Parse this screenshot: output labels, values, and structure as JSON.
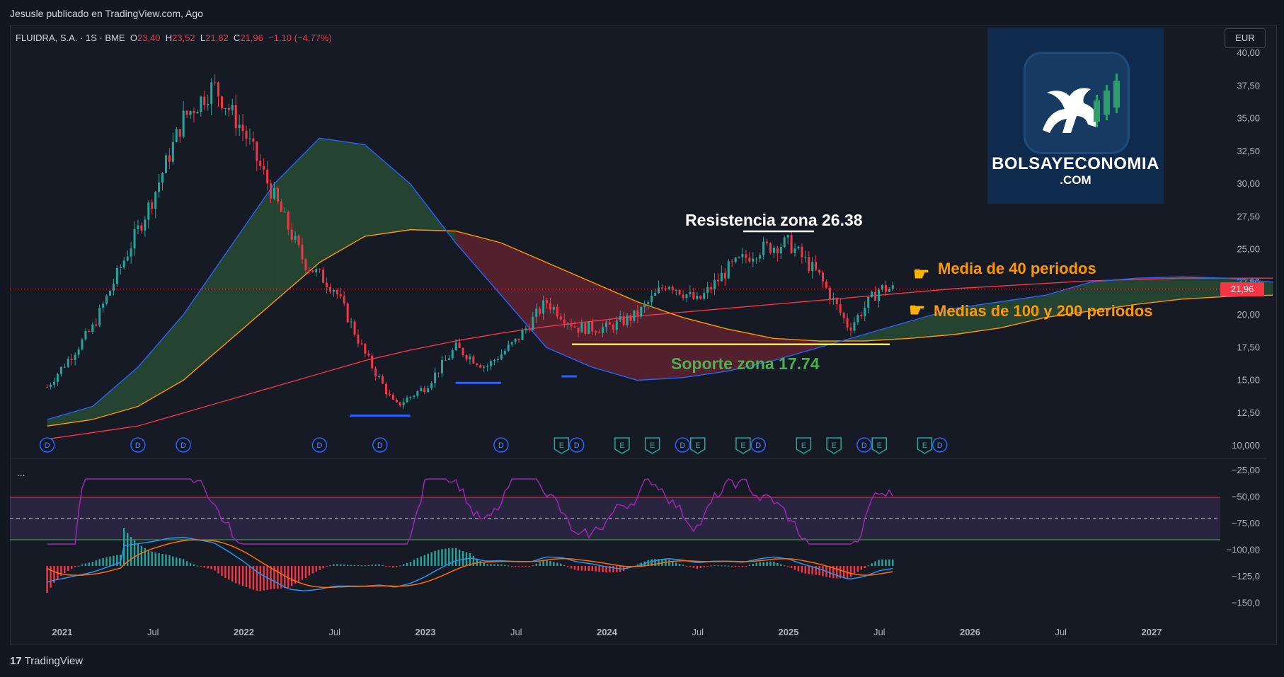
{
  "header": {
    "publisher": "Jesusle publicado en TradingView.com, Ago"
  },
  "legend": {
    "symbol": "FLUIDRA, S.A. · 1S · BME",
    "open_label": "O",
    "open": "23,40",
    "high_label": "H",
    "high": "23,52",
    "low_label": "L",
    "low": "21,82",
    "close_label": "C",
    "close": "21,96",
    "change": "−1,10 (−4,77%)"
  },
  "currency_button": "EUR",
  "last_price_tag": "21,96",
  "logo": {
    "line1": "BOLSAYECONOMIA",
    "line2": ".COM"
  },
  "annotations": {
    "resistance": "Resistencia zona 26.38",
    "support": "Soporte zona 17.74",
    "ma40": "Media de 40 periodos",
    "ma100_200": "Medias de 100 y 200 periodos"
  },
  "footer": {
    "brand": "TradingView"
  },
  "more_indicator_glyph": "...",
  "colors": {
    "background": "#161a25",
    "up": "#26a69a",
    "down": "#f23645",
    "ma40": "#2962ff",
    "ma100": "#ff9800",
    "ma200": "#f23645",
    "rsi": "#9c27b0",
    "macd": "#2196f3",
    "signal": "#ff6d00",
    "resistance_line": "#ffffff",
    "support_line": "#ffeb3b",
    "support_text": "#4caf50",
    "annotation_orange": "#ff9800"
  },
  "chart_data": {
    "type": "candlestick",
    "price_axis": {
      "ticks": [
        "40,00",
        "37,50",
        "35,00",
        "32,50",
        "30,00",
        "27,50",
        "25,00",
        "22,50",
        "20,00",
        "17,50",
        "15,00",
        "12,50",
        "10,000"
      ],
      "ylim": [
        10,
        40
      ]
    },
    "time_axis": {
      "labels": [
        "2021",
        "Jul",
        "2022",
        "Jul",
        "2023",
        "Jul",
        "2024",
        "Jul",
        "2025",
        "Jul",
        "2026",
        "Jul",
        "2027"
      ]
    },
    "key_levels": {
      "resistance": 26.38,
      "support": 17.74,
      "last_close": 21.96
    },
    "price_path": [
      [
        "2020-12",
        14.5
      ],
      [
        "2021-01",
        16
      ],
      [
        "2021-03",
        19
      ],
      [
        "2021-05",
        24
      ],
      [
        "2021-07",
        29
      ],
      [
        "2021-09",
        35
      ],
      [
        "2021-11",
        37.5
      ],
      [
        "2022-01",
        34
      ],
      [
        "2022-03",
        29
      ],
      [
        "2022-05",
        24
      ],
      [
        "2022-07",
        22
      ],
      [
        "2022-09",
        17
      ],
      [
        "2022-11",
        13
      ],
      [
        "2023-01",
        14.5
      ],
      [
        "2023-03",
        17.5
      ],
      [
        "2023-05",
        16
      ],
      [
        "2023-07",
        18
      ],
      [
        "2023-09",
        21
      ],
      [
        "2023-11",
        19
      ],
      [
        "2024-01",
        19
      ],
      [
        "2024-03",
        20
      ],
      [
        "2024-05",
        22.5
      ],
      [
        "2024-07",
        21
      ],
      [
        "2024-09",
        23.5
      ],
      [
        "2024-11",
        25
      ],
      [
        "2025-01",
        25.5
      ],
      [
        "2025-03",
        23
      ],
      [
        "2025-05",
        19
      ],
      [
        "2025-07",
        22
      ],
      [
        "2025-08",
        21.96
      ]
    ],
    "series": [
      {
        "name": "Media de 40 periodos",
        "values": [
          12,
          13,
          16,
          20,
          25,
          30,
          33.5,
          33,
          30,
          25.5,
          21.5,
          17.5,
          16,
          15,
          15.2,
          15.7,
          16.5,
          17.5,
          18.5,
          19.5,
          20.5,
          21,
          21.5,
          22.5,
          22.8,
          22.9,
          22.8,
          22.5
        ]
      },
      {
        "name": "Medias de 100 y 200 periodos",
        "values": [
          11.5,
          12,
          13,
          15,
          18,
          21,
          24,
          26,
          26.5,
          26.4,
          25.5,
          24,
          22.5,
          21,
          19.8,
          18.9,
          18.2,
          18,
          18,
          18.2,
          18.5,
          19,
          19.8,
          20.3,
          20.8,
          21.2,
          21.4,
          21.5
        ]
      },
      {
        "name": "Medias de 100 y 200 periodos",
        "values": [
          10.5,
          11,
          11.5,
          12.5,
          13.5,
          14.5,
          15.5,
          16.5,
          17.3,
          18,
          18.6,
          19.1,
          19.5,
          19.9,
          20.2,
          20.5,
          20.8,
          21.1,
          21.4,
          21.7,
          22,
          22.2,
          22.4,
          22.6,
          22.7,
          22.8,
          22.8,
          22.8
        ]
      }
    ],
    "event_markers": [
      {
        "t": "2020-12",
        "tag": "D"
      },
      {
        "t": "2021-06",
        "tag": "D"
      },
      {
        "t": "2021-09",
        "tag": "D"
      },
      {
        "t": "2022-06",
        "tag": "D"
      },
      {
        "t": "2022-10",
        "tag": "D"
      },
      {
        "t": "2023-06",
        "tag": "D"
      },
      {
        "t": "2023-10",
        "tag": "E"
      },
      {
        "t": "2023-11",
        "tag": "D"
      },
      {
        "t": "2024-02",
        "tag": "E"
      },
      {
        "t": "2024-04",
        "tag": "E"
      },
      {
        "t": "2024-06",
        "tag": "D"
      },
      {
        "t": "2024-07",
        "tag": "E"
      },
      {
        "t": "2024-10",
        "tag": "E"
      },
      {
        "t": "2024-11",
        "tag": "D"
      },
      {
        "t": "2025-02",
        "tag": "E"
      },
      {
        "t": "2025-04",
        "tag": "E"
      },
      {
        "t": "2025-06",
        "tag": "D"
      },
      {
        "t": "2025-07",
        "tag": "E"
      },
      {
        "t": "2025-10",
        "tag": "E"
      },
      {
        "t": "2025-11",
        "tag": "D"
      }
    ],
    "oscillator_axis": {
      "ticks": [
        "−25,00",
        "−50,00",
        "−75,00",
        "−100,00",
        "−125,0",
        "−150,0"
      ]
    }
  }
}
